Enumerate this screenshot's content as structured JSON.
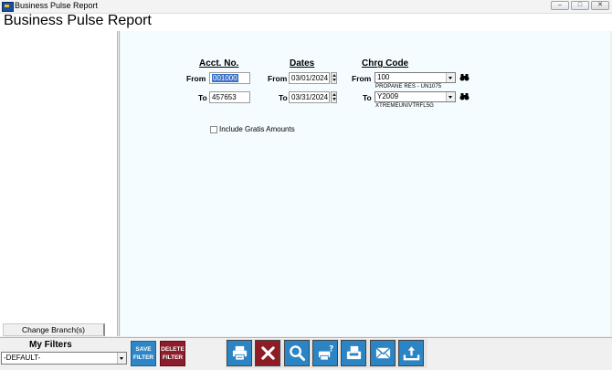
{
  "window": {
    "title": "Business Pulse Report"
  },
  "page": {
    "title": "Business Pulse Report"
  },
  "acct": {
    "header": "Acct. No.",
    "from_label": "From",
    "from_value": "001000",
    "to_label": "To",
    "to_value": "457653"
  },
  "dates": {
    "header": "Dates",
    "from_label": "From",
    "from_value": "03/01/2024",
    "to_label": "To",
    "to_value": "03/31/2024"
  },
  "chrg": {
    "header": "Chrg Code",
    "from_label": "From",
    "from_value": "100",
    "from_desc": "PROPANE RES - UN1075",
    "to_label": "To",
    "to_value": "Y2009",
    "to_desc": "XTREMEUNIVTRFL5G"
  },
  "gratis": {
    "label": "Include Gratis Amounts",
    "checked": false
  },
  "sidebar": {
    "change_branch_label": "Change Branch(s)"
  },
  "filters": {
    "title": "My Filters",
    "selected": "-DEFAULT-",
    "save_line1": "SAVE",
    "save_line2": "FILTER",
    "delete_line1": "DELETE",
    "delete_line2": "FILTER"
  },
  "toolbar_icons": [
    "printer-icon",
    "cancel-icon",
    "search-icon",
    "print-preview-icon",
    "fax-icon",
    "email-icon",
    "export-icon"
  ],
  "colors": {
    "tool_blue": "#2b84c3",
    "cancel_red": "#8d1c27",
    "selection": "#3a70c8"
  }
}
